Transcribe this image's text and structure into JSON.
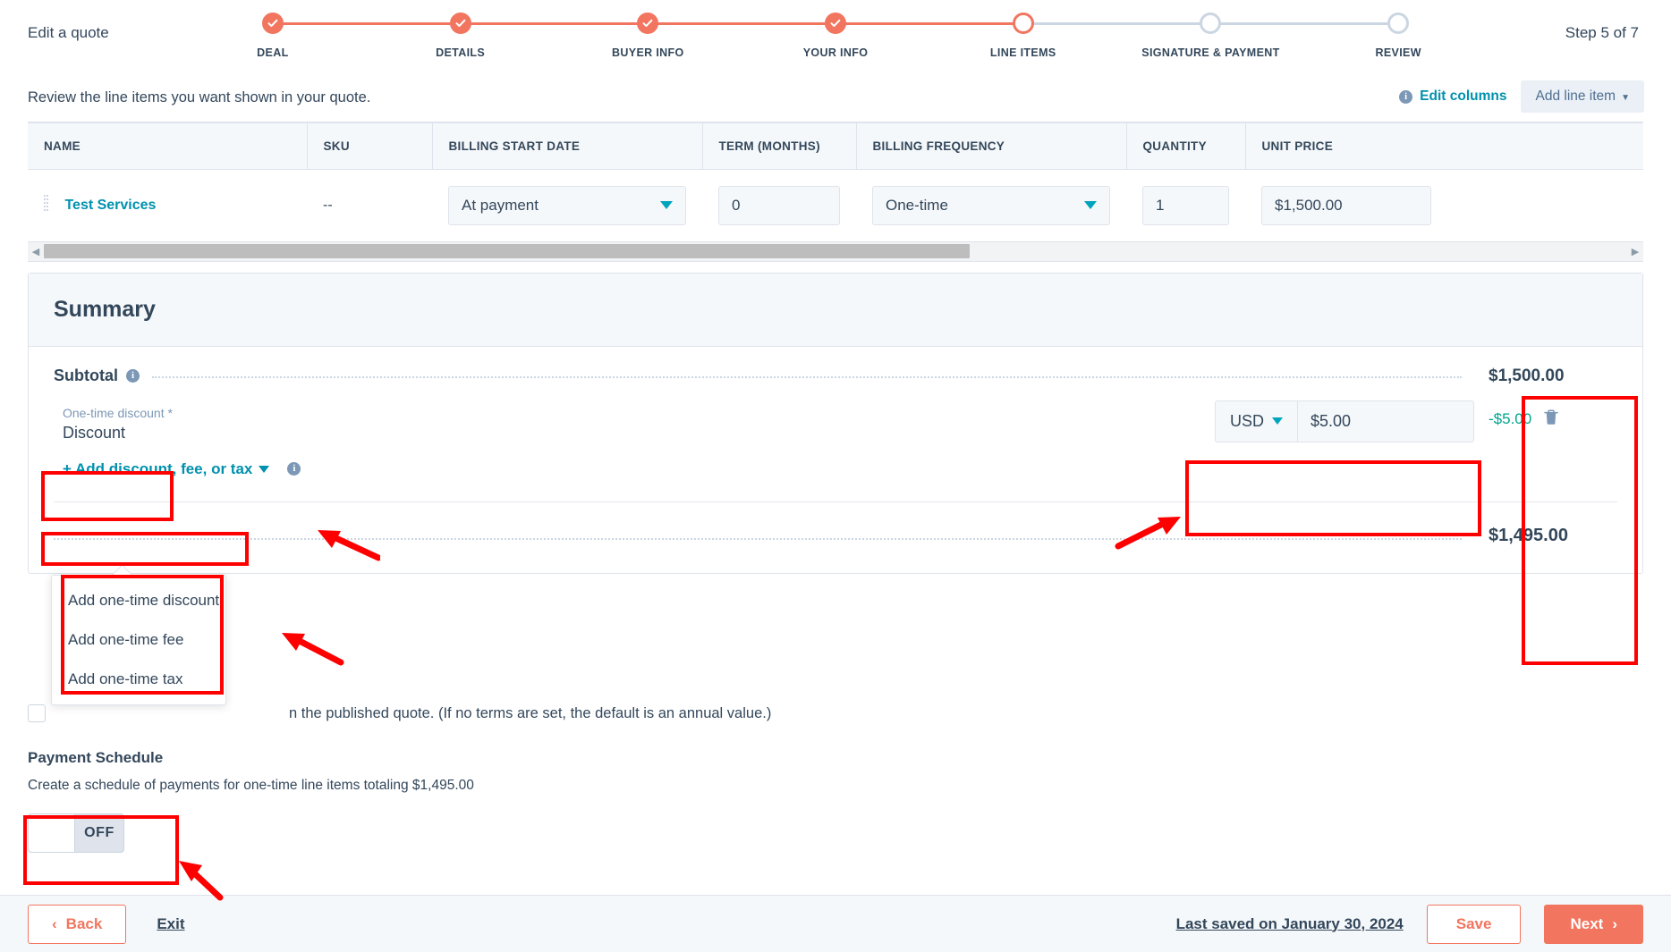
{
  "header": {
    "title": "Edit a quote",
    "step_counter": "Step 5 of 7",
    "steps": [
      {
        "label": "DEAL",
        "state": "done"
      },
      {
        "label": "DETAILS",
        "state": "done"
      },
      {
        "label": "BUYER INFO",
        "state": "done"
      },
      {
        "label": "YOUR INFO",
        "state": "done"
      },
      {
        "label": "LINE ITEMS",
        "state": "current"
      },
      {
        "label": "SIGNATURE & PAYMENT",
        "state": "todo"
      },
      {
        "label": "REVIEW",
        "state": "todo"
      }
    ]
  },
  "subheader": {
    "intro": "Review the line items you want shown in your quote.",
    "edit_columns_label": "Edit columns",
    "add_line_item_label": "Add line item"
  },
  "table": {
    "columns": [
      "NAME",
      "SKU",
      "BILLING START DATE",
      "TERM (MONTHS)",
      "BILLING FREQUENCY",
      "QUANTITY",
      "UNIT PRICE"
    ],
    "rows": [
      {
        "name": "Test Services",
        "sku": "--",
        "billing_start_date": "At payment",
        "term_months": "0",
        "billing_frequency": "One-time",
        "quantity": "1",
        "unit_price": "$1,500.00"
      }
    ]
  },
  "summary": {
    "title": "Summary",
    "subtotal_label": "Subtotal",
    "subtotal_amount": "$1,500.00",
    "discount": {
      "field_label": "One-time discount *",
      "field_value": "Discount",
      "currency": "USD",
      "amount_input": "$5.00",
      "applied_amount": "-$5.00"
    },
    "add_menu_label": "+ Add discount, fee, or tax",
    "add_menu_items": [
      "Add one-time discount",
      "Add one-time fee",
      "Add one-time tax"
    ],
    "total_amount": "$1,495.00"
  },
  "terms": {
    "checkbox_text": "n the published quote. (If no terms are set, the default is an annual value.)",
    "checked": false
  },
  "payment_schedule": {
    "title": "Payment Schedule",
    "description": "Create a schedule of payments for one-time line items totaling $1,495.00",
    "toggle_label": "OFF",
    "toggle_state": "off"
  },
  "footer": {
    "back_label": "Back",
    "exit_label": "Exit",
    "last_saved_label": "Last saved on January 30, 2024",
    "save_label": "Save",
    "next_label": "Next"
  },
  "colors": {
    "brand_orange": "#f2755f",
    "teal": "#0091ae",
    "green": "#00a38d",
    "navy": "#33475b",
    "annotation_red": "#ff0000"
  }
}
